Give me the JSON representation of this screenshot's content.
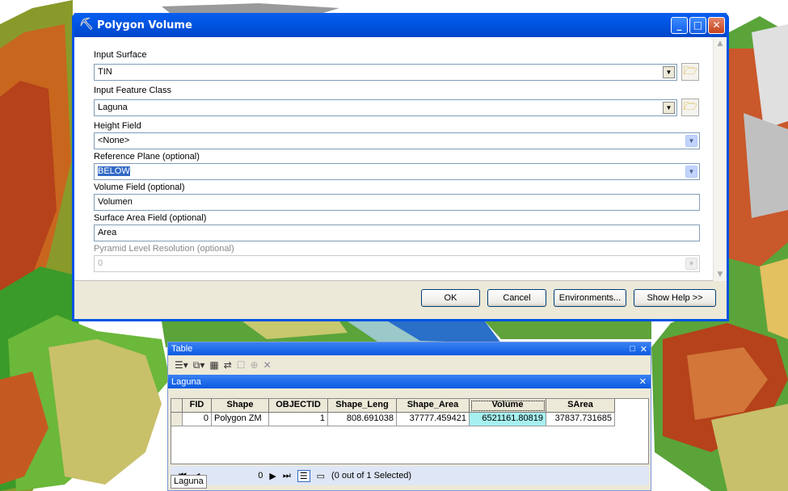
{
  "dialog": {
    "title": "Polygon Volume",
    "fields": [
      {
        "label": "Input Surface",
        "value": "TIN"
      },
      {
        "label": "Input Feature Class",
        "value": "Laguna"
      },
      {
        "label": "Height Field",
        "value": "<None>"
      },
      {
        "label": "Reference Plane (optional)",
        "value": "BELOW"
      },
      {
        "label": "Volume Field (optional)",
        "value": "Volumen"
      },
      {
        "label": "Surface Area Field (optional)",
        "value": "Area"
      },
      {
        "label": "Pyramid Level Resolution (optional)",
        "value": "0"
      }
    ],
    "buttons": {
      "ok": "OK",
      "cancel": "Cancel",
      "environments": "Environments...",
      "show_help": "Show Help >>"
    }
  },
  "table_window": {
    "title": "Table",
    "layer_title": "Laguna",
    "columns": [
      "FID",
      "Shape",
      "OBJECTID",
      "Shape_Leng",
      "Shape_Area",
      "Volume",
      "SArea"
    ],
    "rows": [
      [
        "0",
        "Polygon ZM",
        "1",
        "808.691038",
        "37777.459421",
        "6521161.80819",
        "37837.731685"
      ]
    ],
    "nav": {
      "page": "0",
      "status": "(0 out of 1 Selected)"
    },
    "tab_label": "Laguna"
  },
  "colors": {
    "title_bar": "#0054e3",
    "dialog_bg": "#ece9d8",
    "selection": "#316ac5",
    "volume_highlight": "#a6f0f0"
  }
}
